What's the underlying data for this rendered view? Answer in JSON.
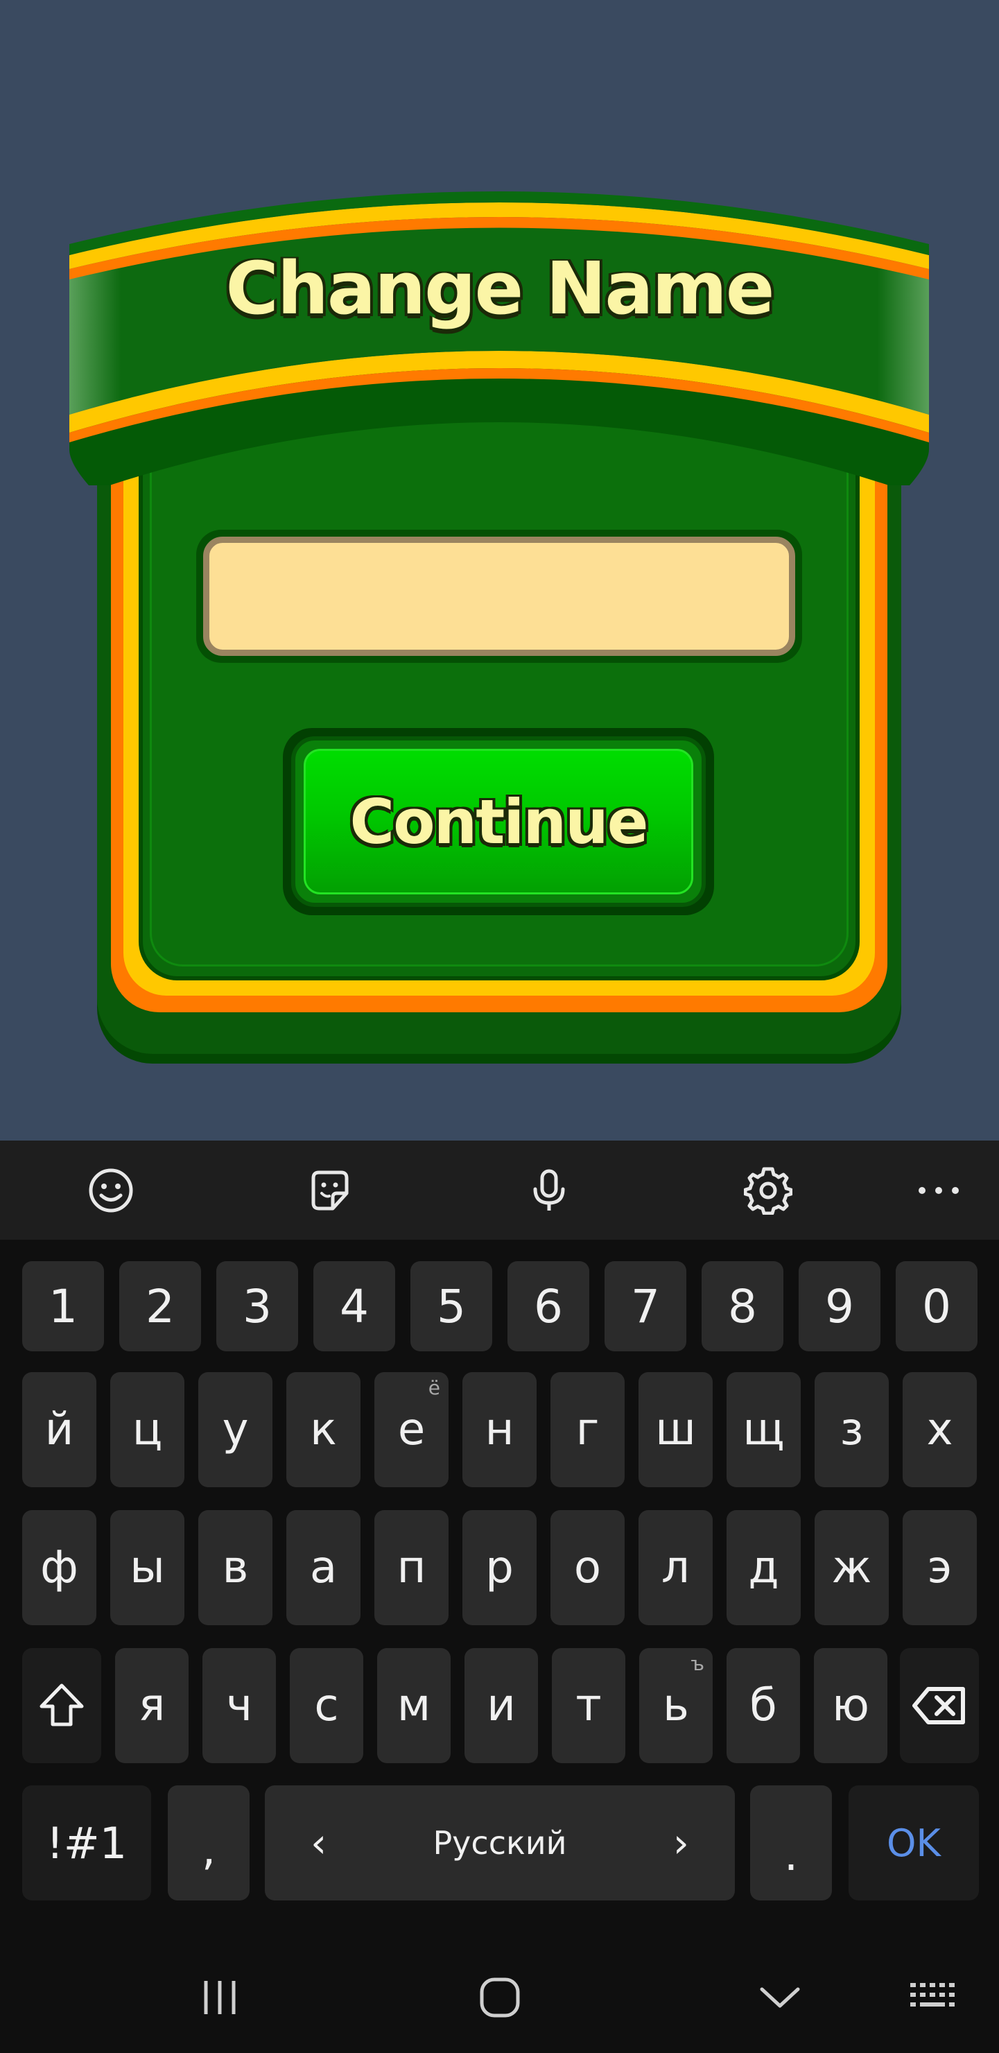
{
  "dialog": {
    "title": "Change Name",
    "name_value": "",
    "continue_label": "Continue"
  },
  "keyboard": {
    "toolbar": [
      "emoji-icon",
      "sticker-icon",
      "microphone-icon",
      "settings-icon",
      "more-icon"
    ],
    "row_numbers": [
      "1",
      "2",
      "3",
      "4",
      "5",
      "6",
      "7",
      "8",
      "9",
      "0"
    ],
    "row1": [
      {
        "k": "й",
        "h": ""
      },
      {
        "k": "ц",
        "h": ""
      },
      {
        "k": "у",
        "h": ""
      },
      {
        "k": "к",
        "h": ""
      },
      {
        "k": "е",
        "h": "ё"
      },
      {
        "k": "н",
        "h": ""
      },
      {
        "k": "г",
        "h": ""
      },
      {
        "k": "ш",
        "h": ""
      },
      {
        "k": "щ",
        "h": ""
      },
      {
        "k": "з",
        "h": ""
      },
      {
        "k": "х",
        "h": ""
      }
    ],
    "row2": [
      {
        "k": "ф",
        "h": ""
      },
      {
        "k": "ы",
        "h": ""
      },
      {
        "k": "в",
        "h": ""
      },
      {
        "k": "а",
        "h": ""
      },
      {
        "k": "п",
        "h": ""
      },
      {
        "k": "р",
        "h": ""
      },
      {
        "k": "о",
        "h": ""
      },
      {
        "k": "л",
        "h": ""
      },
      {
        "k": "д",
        "h": ""
      },
      {
        "k": "ж",
        "h": ""
      },
      {
        "k": "э",
        "h": ""
      }
    ],
    "row3": [
      {
        "k": "я",
        "h": ""
      },
      {
        "k": "ч",
        "h": ""
      },
      {
        "k": "с",
        "h": ""
      },
      {
        "k": "м",
        "h": ""
      },
      {
        "k": "и",
        "h": ""
      },
      {
        "k": "т",
        "h": ""
      },
      {
        "k": "ь",
        "h": "ъ"
      },
      {
        "k": "б",
        "h": ""
      },
      {
        "k": "ю",
        "h": ""
      }
    ],
    "symbols_label": "!#1",
    "comma_label": ",",
    "space_label": "Русский",
    "space_left": "‹",
    "space_right": "›",
    "period_label": ".",
    "ok_label": "OK",
    "ok_color": "#5b8fe8"
  },
  "colors": {
    "background": "#3a4a60",
    "panel_green": "#0b6a0b",
    "button_green": "#00cc00",
    "title_text": "#fbf5a6",
    "input_fill": "#fddf95"
  }
}
